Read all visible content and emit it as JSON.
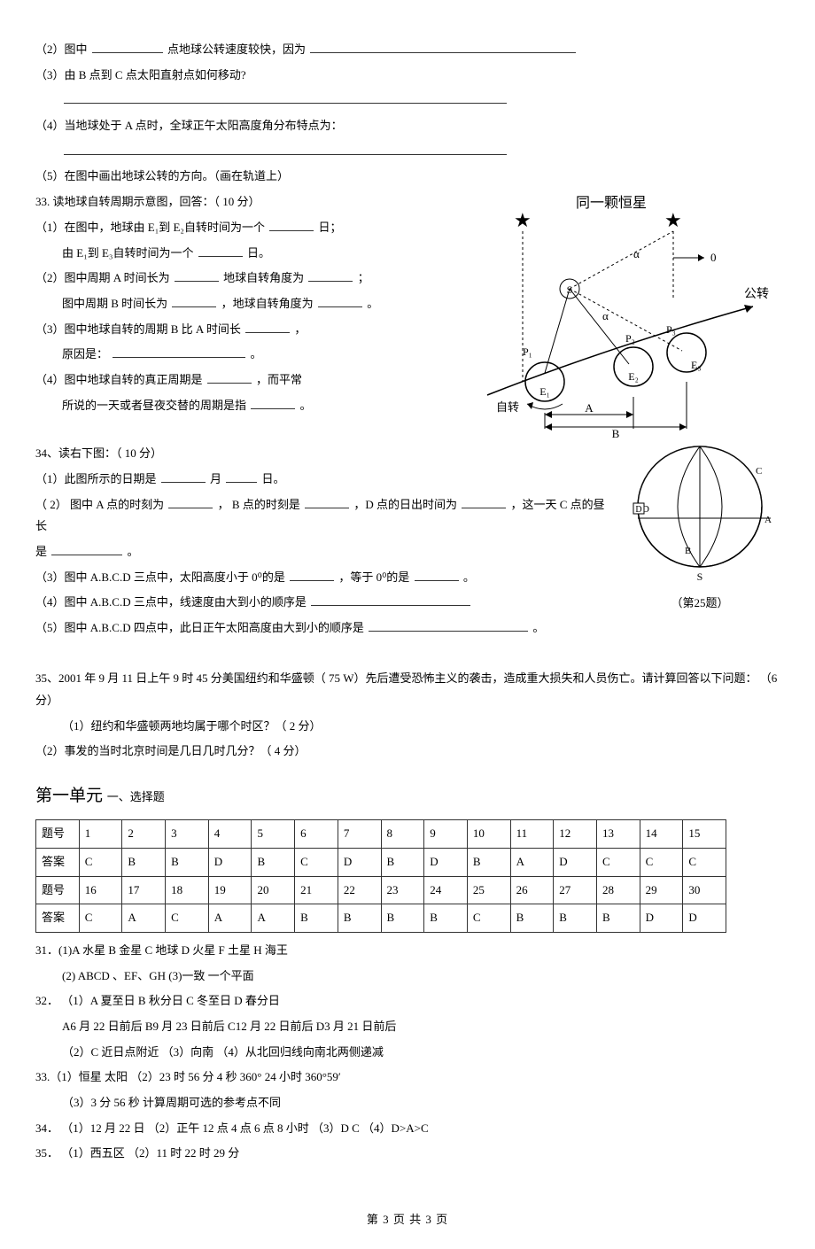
{
  "q32": {
    "l2": "（2）图中",
    "l2b": "点地球公转速度较快，因为",
    "l3": "（3）由 B 点到 C 点太阳直射点如何移动?",
    "l4": "（4）当地球处于  A 点时，全球正午太阳高度角分布特点为：",
    "l5": "（5）在图中画出地球公转的方向。（画在轨道上）"
  },
  "q33": {
    "head": "33. 读地球自转周期示意图，回答：（   10 分）",
    "p1a": "（1）在图中，地球由  E₁到 E₂自转时间为一个",
    "p1a_end": "日；",
    "p1b": "由 E₁到 E₃自转时间为一个",
    "p1b_end": "日。",
    "p2a": "（2）图中周期 A 时间长为",
    "p2a_mid": "地球自转角度为",
    "p2a_end": "；",
    "p2b": "图中周期 B 时间长为",
    "p2b_mid": "，地球自转角度为",
    "p2b_end": "。",
    "p3a": "（3）图中地球自转的周期  B 比 A 时间长",
    "p3a_end": "，",
    "p3b": "原因是：",
    "p3b_end": "。",
    "p4a": "（4）图中地球自转的真正周期是",
    "p4a_end": "，而平常",
    "p4b": "所说的一天或者昼夜交替的周期是指",
    "p4b_end": "。",
    "fig_title": "同一颗恒星",
    "fig_zizhuan": "自转",
    "fig_gongzhuan": "公转",
    "fig_S": "S",
    "fig_0": "0",
    "fig_a": "α",
    "fig_P1": "P₁",
    "fig_P2": "P₂",
    "fig_P3": "P₃",
    "fig_E1": "E₁",
    "fig_E2": "E₂",
    "fig_E3": "E₃",
    "fig_A": "A",
    "fig_B": "B"
  },
  "q34": {
    "head": "34、读右下图：（ 10 分）",
    "p1a": "（1）此图所示的日期是",
    "p1b": "月",
    "p1c": "日。",
    "p2a": "（ 2） 图中  A 点的时刻为",
    "p2b": "， B 点的时刻是",
    "p2c": "，D 点的日出时间为",
    "p2d": "，这一天  C 点的昼长",
    "p2e": "是",
    "p2f": "。",
    "p3a": "（3）图中 A.B.C.D 三点中，太阳高度小于   0⁰的是",
    "p3b": "，等于 0⁰的是",
    "p3c": "。",
    "p4a": "（4）图中 A.B.C.D 三点中，线速度由大到小的顺序是",
    "p5a": "（5）图中 A.B.C.D 四点中，此日正午太阳高度由大到小的顺序是",
    "p5b": "。",
    "fig_A": "A",
    "fig_B": "B",
    "fig_C": "C",
    "fig_D": "D",
    "fig_S": "S",
    "fig_caption": "（第25题）"
  },
  "q35": {
    "head": "35、2001 年 9 月 11 日上午  9 时 45 分美国纽约和华盛顿（   75 W）先后遭受恐怖主义的袭击，造成重大损失和人员伤亡。请计算回答以下问题：  （6 分）",
    "p1": "（1）纽约和华盛顿两地均属于哪个时区？（    2 分）",
    "p2": "（2）事发的当时北京时间是几日几时几分？（    4 分）"
  },
  "answers_title": "第一单元",
  "answers_sub": "一、选择题",
  "table": {
    "rows": [
      [
        "题号",
        "1",
        "2",
        "3",
        "4",
        "5",
        "6",
        "7",
        "8",
        "9",
        "10",
        "11",
        "12",
        "13",
        "14",
        "15"
      ],
      [
        "答案",
        "C",
        "B",
        "B",
        "D",
        "B",
        "C",
        "D",
        "B",
        "D",
        "B",
        "A",
        "D",
        "C",
        "C",
        "C"
      ],
      [
        "题号",
        "16",
        "17",
        "18",
        "19",
        "20",
        "21",
        "22",
        "23",
        "24",
        "25",
        "26",
        "27",
        "28",
        "29",
        "30"
      ],
      [
        "答案",
        "C",
        "A",
        "C",
        "A",
        "A",
        "B",
        "B",
        "B",
        "B",
        "C",
        "B",
        "B",
        "B",
        "D",
        "D"
      ]
    ]
  },
  "ans_text": {
    "a31_1": "31．(1)A 水星    B 金星    C 地球    D 火星    F 土星    H 海王",
    "a31_2": "(2) ABCD 、EF、GH        (3)一致    一个平面",
    "a32_1": "32． （1）A 夏至日    B 秋分日    C 冬至日    D 春分日",
    "a32_1b": "A6 月 22 日前后    B9 月 23 日前后    C12 月 22 日前后    D3 月 21 日前后",
    "a32_2": "（2）C    近日点附近    （3）向南    （4）从北回归线向南北两侧递减",
    "a33": "33.（1）恒星    太阳  （2）23 时 56 分 4 秒   360°   24 小时   360°59′",
    "a33b": "（3）3 分 56 秒    计算周期可选的参考点不同",
    "a34": "34． （1）12 月 22 日    （2）正午 12 点   4 点   6 点   8 小时   （3）D C   （4）D>A>C",
    "a35": "35． （1）西五区     （2）11 时 22 时 29 分"
  },
  "footer": "第 3 页 共 3 页"
}
